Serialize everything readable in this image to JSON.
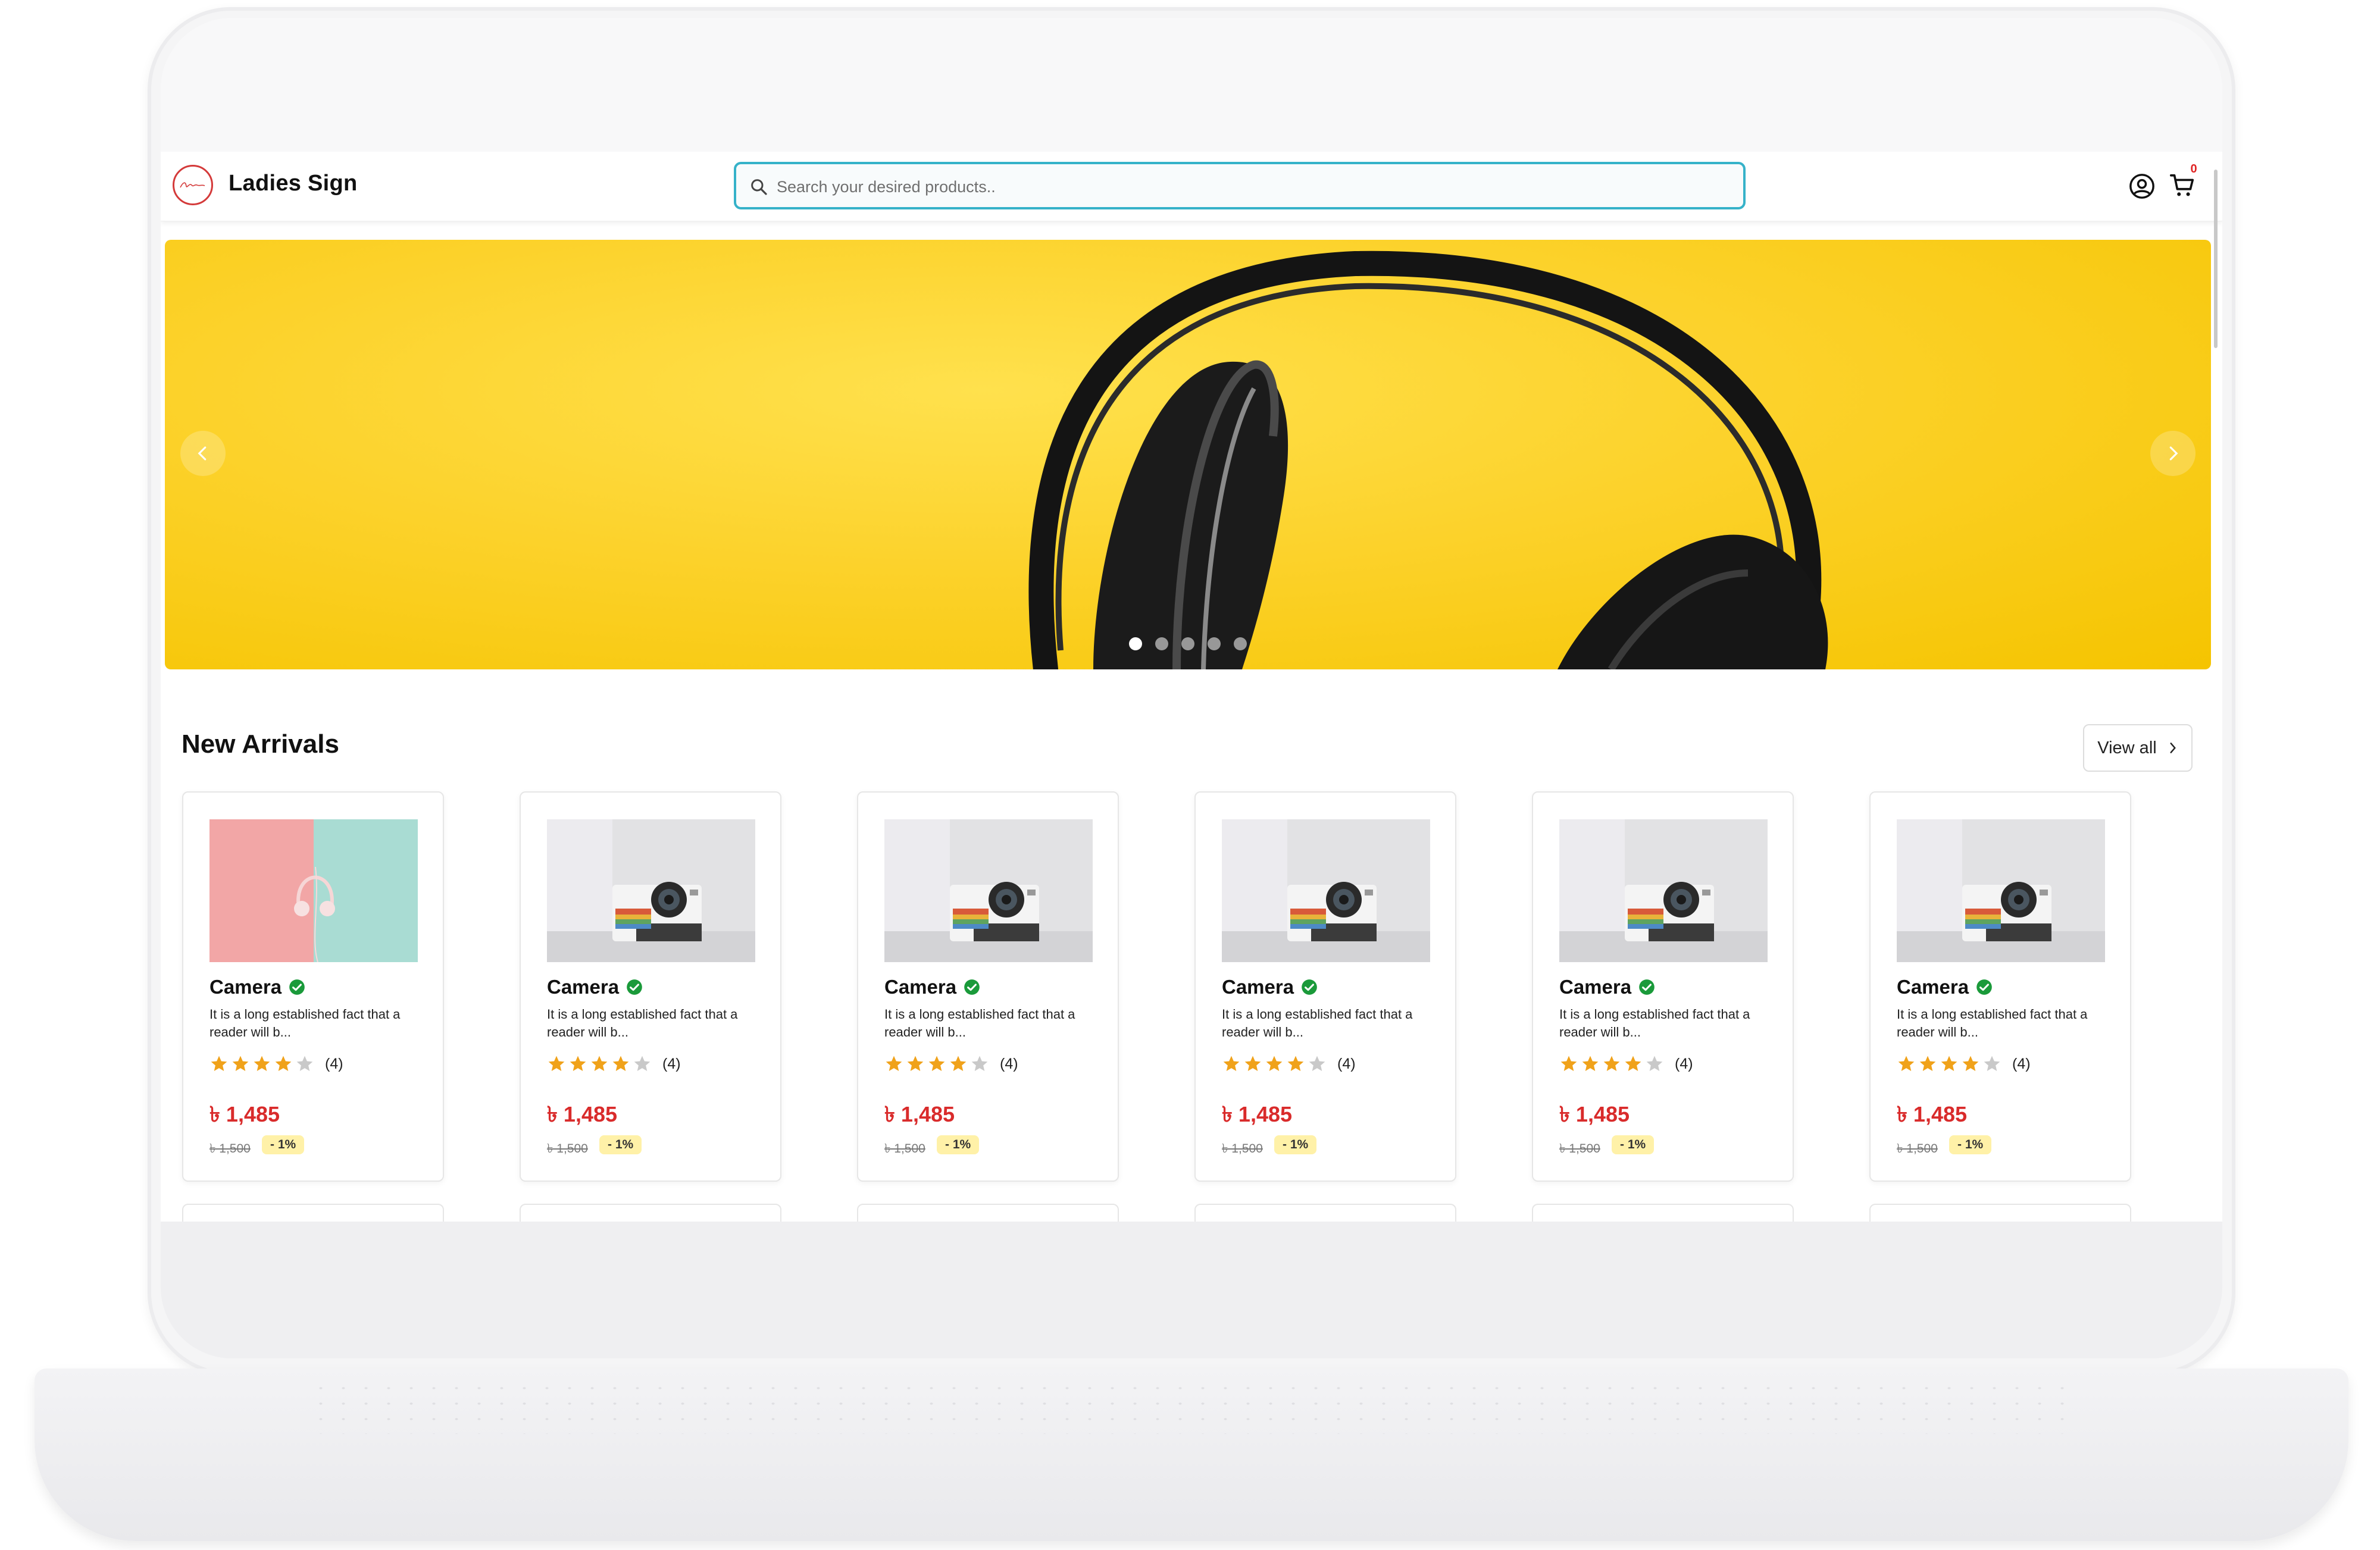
{
  "brand": {
    "name": "Ladies Sign",
    "logo_icon": "ladies-sign-logo"
  },
  "search": {
    "placeholder": "Search your desired products..",
    "value": ""
  },
  "header": {
    "user_icon": "user-circle-icon",
    "cart_icon": "cart-icon",
    "cart_count": "0"
  },
  "banner": {
    "slides": 5,
    "active_slide": 1,
    "image": "black headphones on yellow background"
  },
  "section": {
    "title": "New Arrivals",
    "view_all_label": "View all"
  },
  "products": [
    {
      "title": "Camera",
      "description": "It is a long established fact that a reader will b...",
      "rating": 4,
      "rating_label": "(4)",
      "price": "৳ 1,485",
      "old_price": "৳ 1,500",
      "discount": "- 1%",
      "image": "headphones-pink-mint"
    },
    {
      "title": "Camera",
      "description": "It is a long established fact that a reader will b...",
      "rating": 4,
      "rating_label": "(4)",
      "price": "৳ 1,485",
      "old_price": "৳ 1,500",
      "discount": "- 1%",
      "image": "instant-camera"
    },
    {
      "title": "Camera",
      "description": "It is a long established fact that a reader will b...",
      "rating": 4,
      "rating_label": "(4)",
      "price": "৳ 1,485",
      "old_price": "৳ 1,500",
      "discount": "- 1%",
      "image": "instant-camera"
    },
    {
      "title": "Camera",
      "description": "It is a long established fact that a reader will b...",
      "rating": 4,
      "rating_label": "(4)",
      "price": "৳ 1,485",
      "old_price": "৳ 1,500",
      "discount": "- 1%",
      "image": "instant-camera"
    },
    {
      "title": "Camera",
      "description": "It is a long established fact that a reader will b...",
      "rating": 4,
      "rating_label": "(4)",
      "price": "৳ 1,485",
      "old_price": "৳ 1,500",
      "discount": "- 1%",
      "image": "instant-camera"
    },
    {
      "title": "Camera",
      "description": "It is a long established fact that a reader will b...",
      "rating": 4,
      "rating_label": "(4)",
      "price": "৳ 1,485",
      "old_price": "৳ 1,500",
      "discount": "- 1%",
      "image": "instant-camera"
    }
  ],
  "colors": {
    "accent": "#36b2c9",
    "price": "#d92b2b",
    "star": "#f0a21a",
    "verified": "#1a9a3a",
    "discount_bg": "#fff1a8",
    "banner": "#fcd22b"
  }
}
